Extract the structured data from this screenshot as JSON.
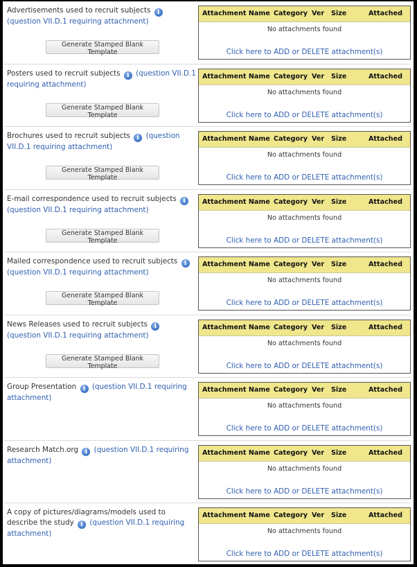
{
  "columns": [
    "Attachment Name",
    "Category",
    "Ver",
    "Size",
    "Attached"
  ],
  "no_attachments_text": "No attachments found",
  "add_delete_link": "Click here to ADD or DELETE attachment(s)",
  "generate_button_label": "Generate Stamped Blank Template",
  "info_icon": "info-icon",
  "colors": {
    "header_bg": "#f0e68c",
    "link": "#2f5fb0"
  },
  "sections": [
    {
      "label": "Advertisements used to recruit subjects",
      "link": "(question VII.D.1 requiring attachment)",
      "has_button": true
    },
    {
      "label": "Posters used to recruit subjects",
      "link": "(question VII.D.1 requiring attachment)",
      "has_button": true
    },
    {
      "label": "Brochures used to recruit subjects",
      "link": "(question VII.D.1 requiring attachment)",
      "has_button": true
    },
    {
      "label": "E-mail correspondence used to recruit subjects",
      "link": "(question VII.D.1 requiring attachment)",
      "has_button": true
    },
    {
      "label": "Mailed correspondence used to recruit subjects",
      "link": "(question VII.D.1 requiring attachment)",
      "has_button": true
    },
    {
      "label": "News Releases used to recruit subjects",
      "link": "(question VII.D.1 requiring attachment)",
      "has_button": true
    },
    {
      "label": "Group Presentation",
      "link": "(question VII.D.1 requiring attachment)",
      "has_button": false
    },
    {
      "label": "Research Match.org",
      "link": "(question VII.D.1 requiring attachment)",
      "has_button": false
    },
    {
      "label": "A copy of pictures/diagrams/models used to describe the study",
      "link": "(question VII.D.1 requiring attachment)",
      "has_button": false
    }
  ]
}
